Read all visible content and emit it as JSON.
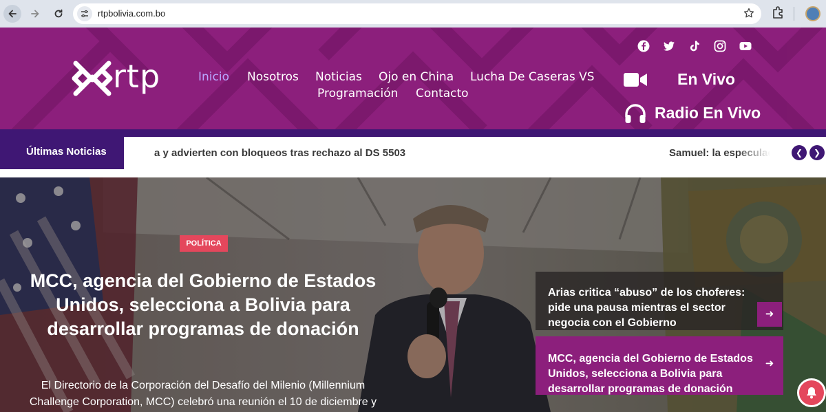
{
  "browser": {
    "url": "rtpbolivia.com.bo"
  },
  "site": {
    "logo_text": "rtp",
    "nav": [
      {
        "label": "Inicio"
      },
      {
        "label": "Nosotros"
      },
      {
        "label": "Noticias"
      },
      {
        "label": "Ojo en China"
      },
      {
        "label": "Lucha De Caseras VS"
      },
      {
        "label": "Programación"
      },
      {
        "label": "Contacto"
      }
    ],
    "social_icons": [
      "facebook-icon",
      "twitter-icon",
      "tiktok-icon",
      "instagram-icon",
      "youtube-icon"
    ],
    "live_tv_label": "En Vivo",
    "radio_label": "Radio En Vivo",
    "colors": {
      "brand_purple": "#8c1f7c",
      "ticker_purple": "#3f1774",
      "badge_red": "#e4475c",
      "active_nav": "#b9a6ff"
    }
  },
  "ticker": {
    "label": "Últimas Noticias",
    "items": [
      "a y advierten con bloqueos tras rechazo al DS 5503",
      "Samuel: la especulaci"
    ]
  },
  "hero": {
    "badge": "POLÍTICA",
    "title": "MCC, agencia del Gobierno de Estados Unidos, selecciona a Bolivia para desarrollar programas de donación",
    "excerpt": "El Directorio de la Corporación del Desafío del Milenio (Millennium Challenge Corporation, MCC) celebró una reunión el 10 de diciembre y"
  },
  "side_news": [
    {
      "title": "Arias critica “abuso” de los choferes: pide una pausa mientras el sector negocia con el Gobierno"
    },
    {
      "title": "MCC, agencia del Gobierno de Estados Unidos, selecciona a Bolivia para desarrollar programas de donación"
    }
  ]
}
